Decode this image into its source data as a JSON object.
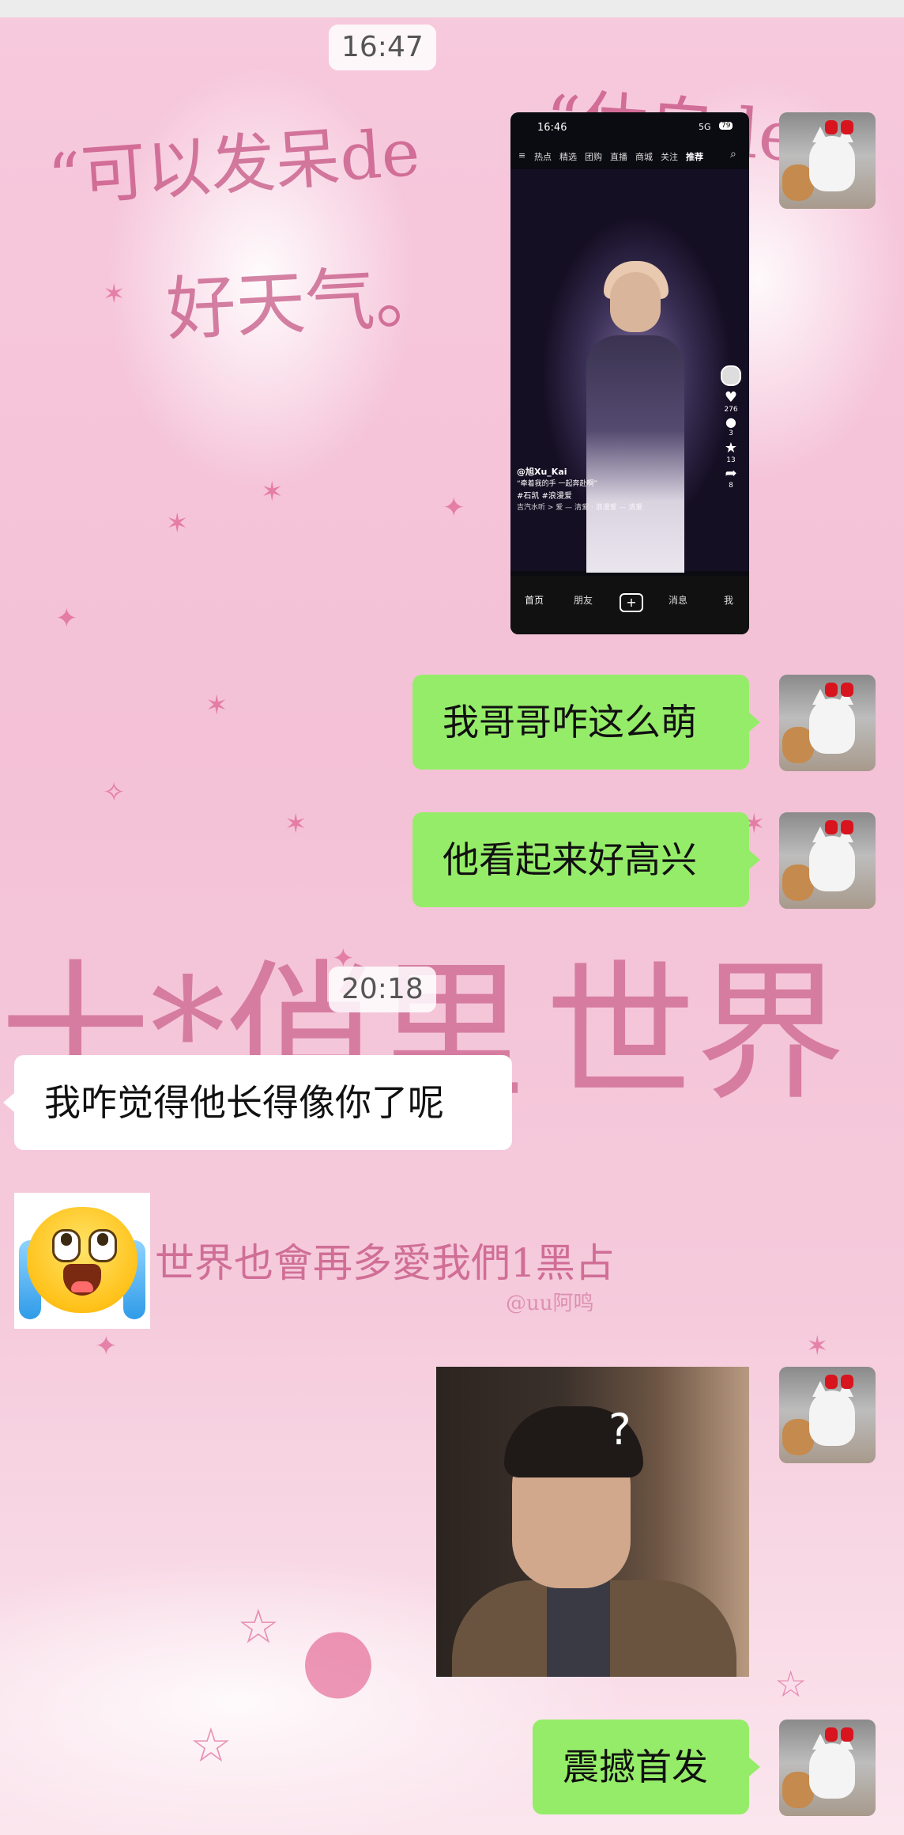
{
  "background": {
    "doodles": [
      "“可以发呆de",
      "好天气。",
      "“休自de",
      "世界也會再多愛我們1黑占",
      "@uu阿鸣"
    ]
  },
  "timestamps": [
    "16:47",
    "20:18"
  ],
  "messages": [
    {
      "side": "me",
      "type": "image",
      "content": "short-video-app-screenshot"
    },
    {
      "side": "me",
      "type": "text",
      "text": "我哥哥咋这么萌"
    },
    {
      "side": "me",
      "type": "text",
      "text": "他看起来好高兴"
    },
    {
      "side": "other",
      "type": "text",
      "text": "我咋觉得他长得像你了呢"
    },
    {
      "side": "other",
      "type": "emoji",
      "content": "crying-face-emoji"
    },
    {
      "side": "me",
      "type": "image",
      "content": "man-photo-question-mark"
    },
    {
      "side": "me",
      "type": "text",
      "text": "震撼首发"
    }
  ],
  "video_screenshot": {
    "status_time": "16:46",
    "status_network": "5G",
    "battery": "79",
    "nav_tabs": [
      "热点",
      "精选",
      "团购",
      "直播",
      "商城",
      "关注",
      "推荐"
    ],
    "side_counts": [
      "276",
      "3",
      "13",
      "8"
    ],
    "author": "@旭Xu_Kai",
    "caption": "“牵着我的手 一起奔赴啊”",
    "hashtags": "#石凯 #浪漫爱",
    "music": "吉汽水听 > 爱 — 清爱 · 浪漫爱 — 清爱",
    "tab_bar": [
      "首页",
      "朋友",
      "+",
      "消息",
      "我"
    ]
  },
  "photo": {
    "overlay": "?"
  },
  "colors": {
    "my_bubble": "#95ec69",
    "their_bubble": "#ffffff",
    "accent_pink": "#f4c1d6"
  }
}
